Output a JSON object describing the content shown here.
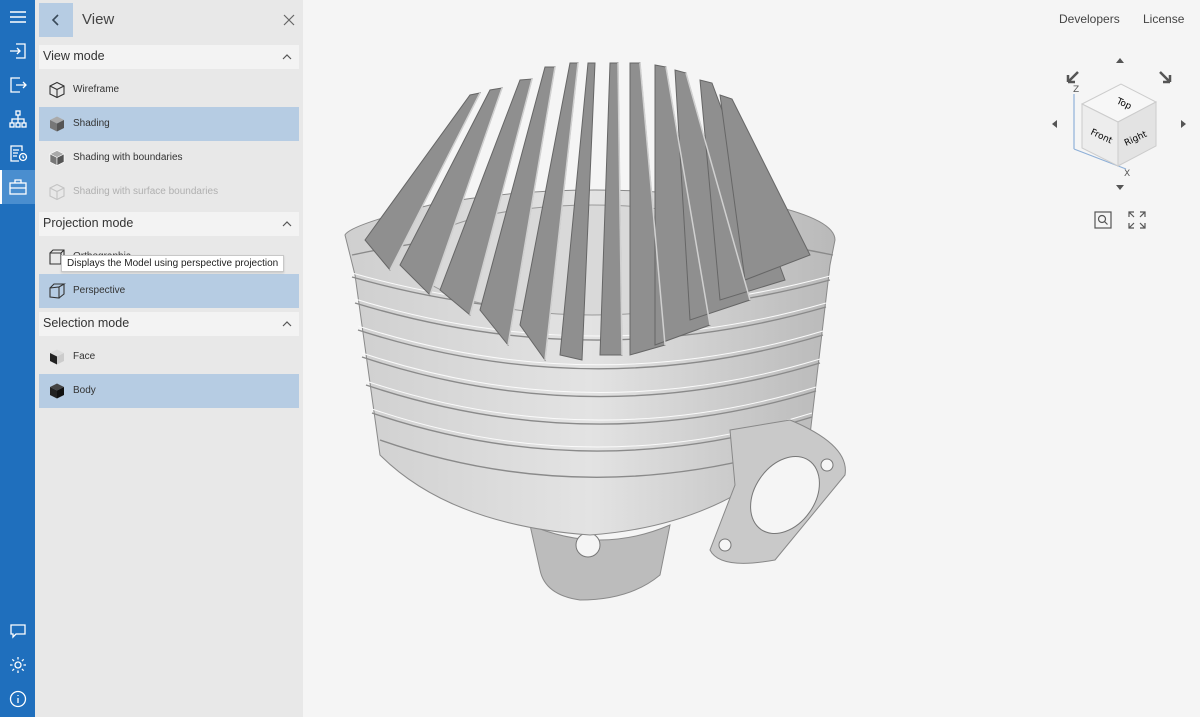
{
  "panel": {
    "title": "View"
  },
  "sections": [
    {
      "label": "View mode"
    },
    {
      "label": "Projection mode"
    },
    {
      "label": "Selection mode"
    }
  ],
  "view_mode_items": [
    {
      "label": "Wireframe",
      "selected": false,
      "disabled": false
    },
    {
      "label": "Shading",
      "selected": true,
      "disabled": false
    },
    {
      "label": "Shading with boundaries",
      "selected": false,
      "disabled": false
    },
    {
      "label": "Shading with surface boundaries",
      "selected": false,
      "disabled": true
    }
  ],
  "projection_items": [
    {
      "label": "Orthographic",
      "selected": false
    },
    {
      "label": "Perspective",
      "selected": true
    }
  ],
  "selection_items": [
    {
      "label": "Face",
      "selected": false
    },
    {
      "label": "Body",
      "selected": true
    }
  ],
  "tooltip": "Displays the Model using perspective projection",
  "header_links": {
    "developers": "Developers",
    "license": "License"
  },
  "navcube": {
    "top": "Top",
    "front": "Front",
    "right": "Right",
    "axis_z": "Z",
    "axis_x": "X"
  },
  "colors": {
    "rail": "#1f6fbd",
    "selected": "#b6cce3",
    "panel": "#e8e8e8",
    "viewer_bg": "#f5f5f5"
  }
}
